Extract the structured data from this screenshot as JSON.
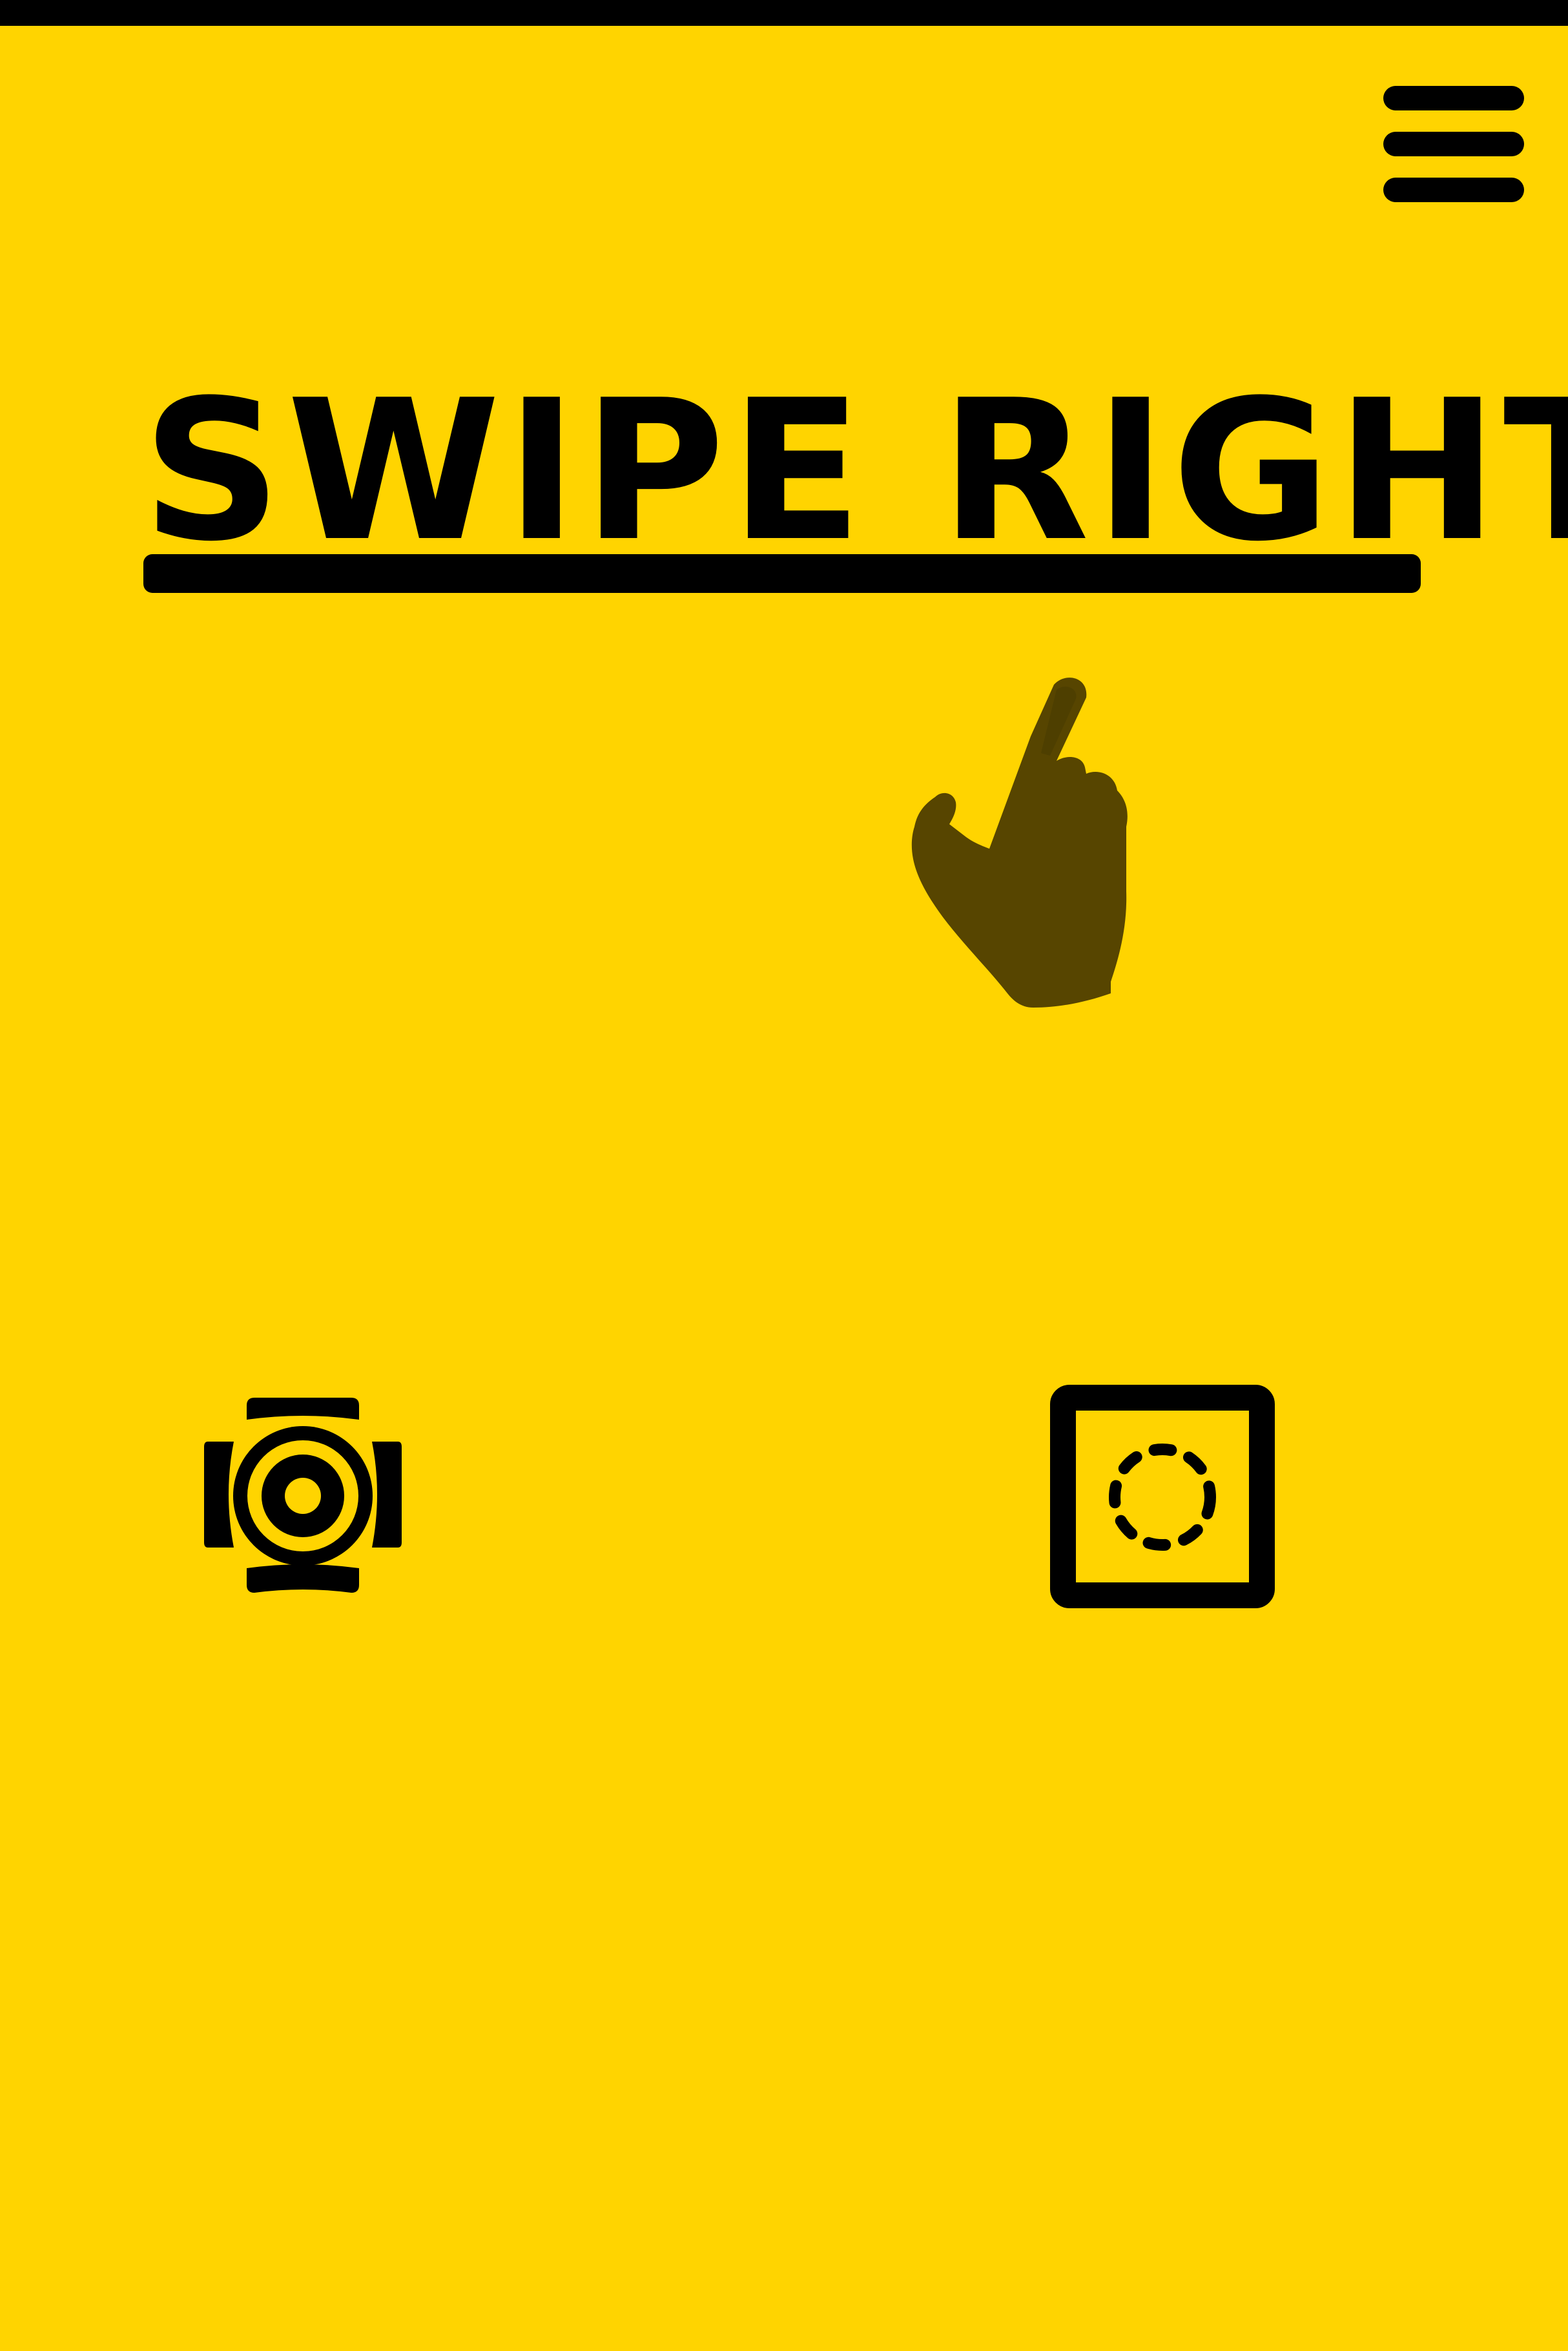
{
  "status_bar": {},
  "menu": {
    "icon": "hamburger-menu-icon"
  },
  "headline": {
    "text": "SWIPE RIGHT"
  },
  "gesture_hint": {
    "icon": "swipe-hand-icon"
  },
  "actions": {
    "camera": {
      "icon": "camera-lens-icon"
    },
    "gallery": {
      "icon": "gallery-frame-icon"
    }
  },
  "colors": {
    "background": "#FFD400",
    "foreground": "#000000",
    "hand": "#574500"
  }
}
